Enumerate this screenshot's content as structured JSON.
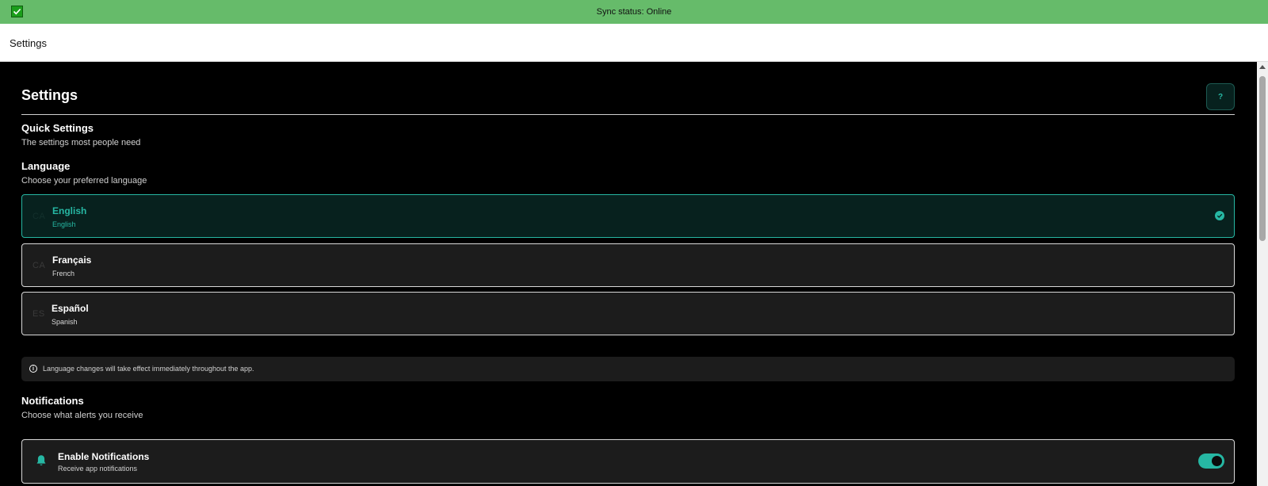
{
  "sync": {
    "status_text": "Sync status: Online"
  },
  "topbar": {
    "title": "Settings"
  },
  "page": {
    "title": "Settings",
    "help_label": "?"
  },
  "quick_settings": {
    "title": "Quick Settings",
    "subtitle": "The settings most people need"
  },
  "language": {
    "title": "Language",
    "subtitle": "Choose your preferred language",
    "options": [
      {
        "code": "CA",
        "name": "English",
        "native": "English",
        "selected": true
      },
      {
        "code": "CA",
        "name": "Français",
        "native": "French",
        "selected": false
      },
      {
        "code": "ES",
        "name": "Español",
        "native": "Spanish",
        "selected": false
      }
    ],
    "info_icon": "i",
    "info_text": "Language changes will take effect immediately throughout the app."
  },
  "notifications": {
    "title": "Notifications",
    "subtitle": "Choose what alerts you receive",
    "enable": {
      "title": "Enable Notifications",
      "subtitle": "Receive app notifications",
      "enabled": true
    }
  },
  "colors": {
    "accent": "#26b7a3",
    "sync_bar": "#66bb6a",
    "card_bg": "#1c1c1c"
  },
  "icons": [
    "checkbox-checked-icon",
    "help-icon",
    "check-circle-icon",
    "info-icon",
    "bell-icon"
  ]
}
